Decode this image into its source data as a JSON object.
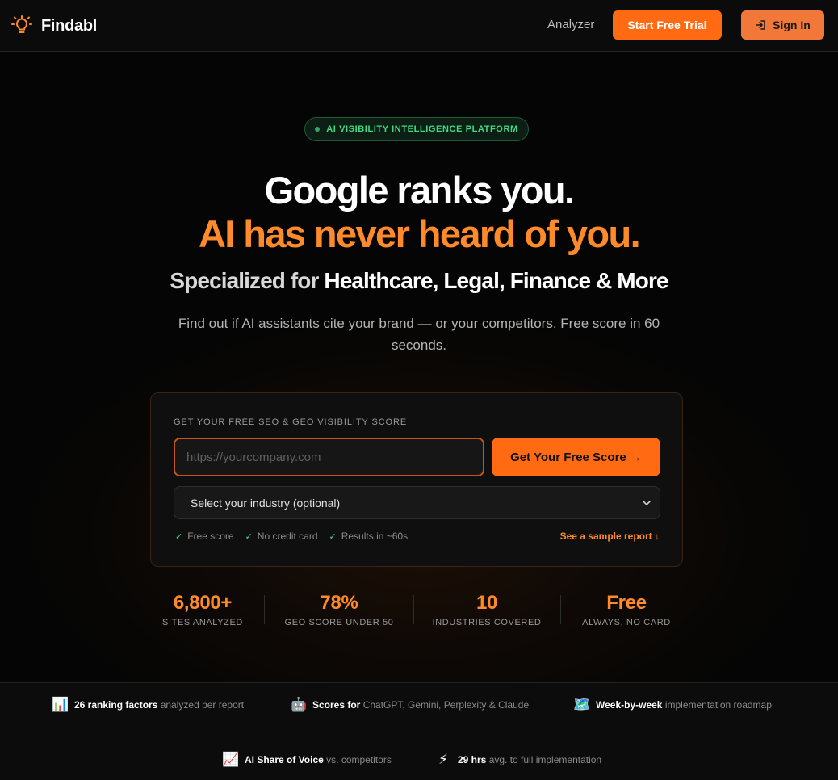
{
  "header": {
    "brand": "Findabl",
    "nav_analyzer": "Analyzer",
    "start_trial": "Start Free Trial",
    "sign_in": "Sign In"
  },
  "hero": {
    "badge": "AI VISIBILITY INTELLIGENCE PLATFORM",
    "headline_line1": "Google ranks you.",
    "headline_line2": "AI has never heard of you.",
    "subheadline_muted": "Specialized for ",
    "subheadline_strong": "Healthcare, Legal, Finance & More",
    "description": "Find out if AI assistants cite your brand — or your competitors. Free score in 60 seconds."
  },
  "form": {
    "label": "GET YOUR FREE SEO & GEO VISIBILITY SCORE",
    "url_placeholder": "https://yourcompany.com",
    "url_value": "",
    "submit": "Get Your Free Score →",
    "industry_selected": "Select your industry (optional)",
    "checks": [
      "Free score",
      "No credit card",
      "Results in ~60s"
    ],
    "sample_link": "See a sample report ↓"
  },
  "stats": [
    {
      "value": "6,800+",
      "label": "SITES ANALYZED"
    },
    {
      "value": "78%",
      "label": "GEO SCORE UNDER 50"
    },
    {
      "value": "10",
      "label": "INDUSTRIES COVERED"
    },
    {
      "value": "Free",
      "label": "ALWAYS, NO CARD"
    }
  ],
  "features": [
    {
      "icon": "bar-chart-icon",
      "emoji": "📊",
      "bold": "26 ranking factors",
      "muted": " analyzed per report"
    },
    {
      "icon": "robot-icon",
      "emoji": "🤖",
      "bold": "Scores for",
      "muted": " ChatGPT, Gemini, Perplexity & Claude"
    },
    {
      "icon": "map-icon",
      "emoji": "🗺️",
      "bold": "Week-by-week",
      "muted": " implementation roadmap"
    },
    {
      "icon": "trending-up-icon",
      "emoji": "📈",
      "bold": "AI Share of Voice",
      "muted": " vs. competitors"
    },
    {
      "icon": "lightning-icon",
      "emoji": "⚡",
      "bold": "29 hrs",
      "muted": " avg. to full implementation"
    }
  ],
  "colors": {
    "accent": "#ff6a13",
    "accent_text": "#ff8a2a",
    "badge_green": "#3ddc84",
    "background": "#050505"
  }
}
